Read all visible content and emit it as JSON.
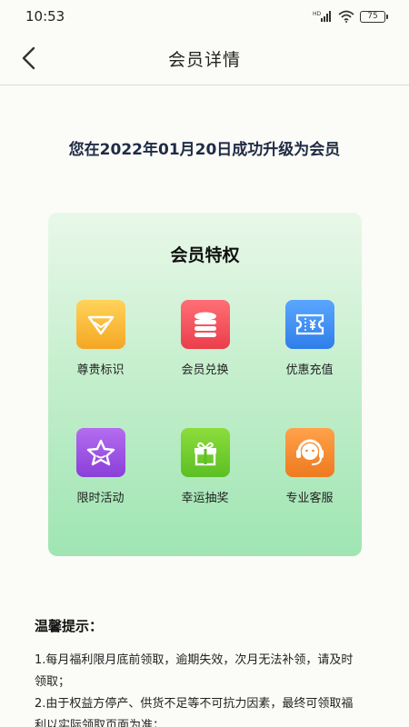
{
  "status_bar": {
    "time": "10:53",
    "network": "HD",
    "battery": "75"
  },
  "nav": {
    "title": "会员详情"
  },
  "upgrade_message": "您在2022年01月20日成功升级为会员",
  "card": {
    "title": "会员特权",
    "items": [
      {
        "label": "尊贵标识",
        "icon": "diamond-icon",
        "color": "#f7b52c"
      },
      {
        "label": "会员兑换",
        "icon": "coin-stack-icon",
        "color": "#f0525d"
      },
      {
        "label": "优惠充值",
        "icon": "yen-ticket-icon",
        "color": "#3f8ef0"
      },
      {
        "label": "限时活动",
        "icon": "star-icon",
        "color": "#9a4fe0"
      },
      {
        "label": "幸运抽奖",
        "icon": "gift-icon",
        "color": "#71cc2e"
      },
      {
        "label": "专业客服",
        "icon": "headset-icon",
        "color": "#f28a2a"
      }
    ]
  },
  "tips": {
    "title": "温馨提示：",
    "lines": [
      "1.每月福利限月底前领取，逾期失效，次月无法补领，请及时",
      "领取；",
      "2.由于权益方停产、供货不足等不可抗力因素，最终可领取福",
      "利以实际领取页面为准；"
    ]
  }
}
